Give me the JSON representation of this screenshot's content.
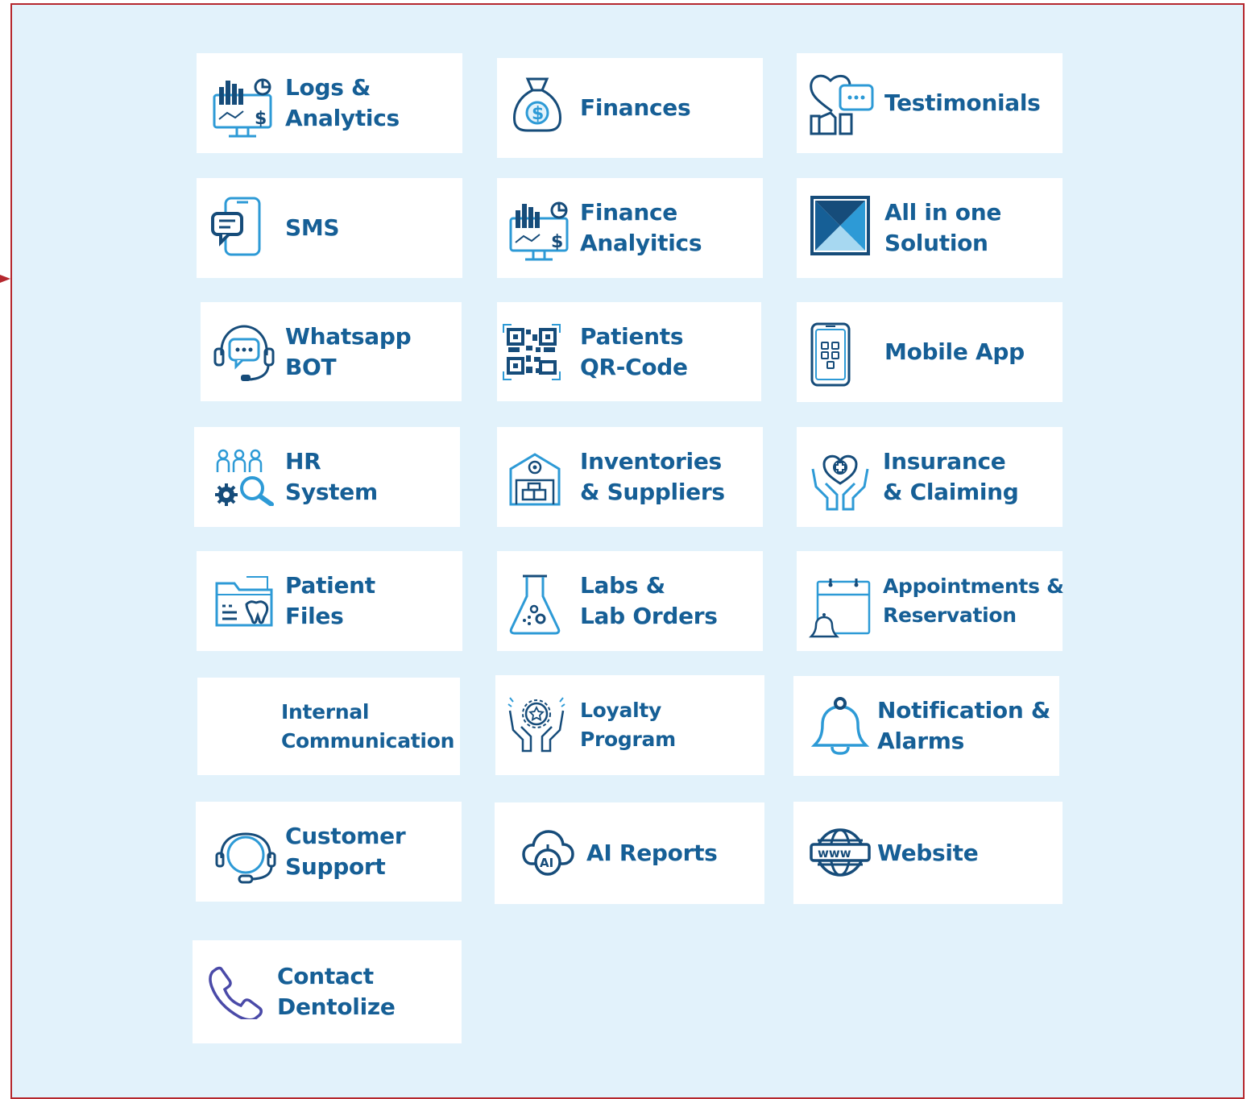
{
  "tiles": [
    {
      "id": "logs-analytics",
      "lines": [
        "Logs &",
        "Analytics"
      ],
      "icon": "analytics-monitor-icon"
    },
    {
      "id": "finances",
      "lines": [
        "Finances"
      ],
      "icon": "money-bag-icon"
    },
    {
      "id": "testimonials",
      "lines": [
        "Testimonials"
      ],
      "icon": "testimonial-heart-chat-icon"
    },
    {
      "id": "sms",
      "lines": [
        "SMS"
      ],
      "icon": "phone-message-icon"
    },
    {
      "id": "finance-analytics",
      "lines": [
        "Finance",
        "Analyitics"
      ],
      "icon": "analytics-monitor-icon"
    },
    {
      "id": "all-in-one",
      "lines": [
        "All in one",
        "Solution"
      ],
      "icon": "solution-logo-icon"
    },
    {
      "id": "whatsapp-bot",
      "lines": [
        "Whatsapp",
        "BOT"
      ],
      "icon": "headset-chat-icon"
    },
    {
      "id": "patients-qr",
      "lines": [
        "Patients",
        "QR-Code"
      ],
      "icon": "qr-code-icon"
    },
    {
      "id": "mobile-app",
      "lines": [
        "Mobile App"
      ],
      "icon": "smartphone-apps-icon"
    },
    {
      "id": "hr-system",
      "lines": [
        "HR",
        "System"
      ],
      "icon": "people-search-icon"
    },
    {
      "id": "inventories",
      "lines": [
        "Inventories",
        "& Suppliers"
      ],
      "icon": "warehouse-icon"
    },
    {
      "id": "insurance",
      "lines": [
        "Insurance",
        "& Claiming"
      ],
      "icon": "hands-heart-icon"
    },
    {
      "id": "patient-files",
      "lines": [
        "Patient",
        "Files"
      ],
      "icon": "dental-folder-icon"
    },
    {
      "id": "labs",
      "lines": [
        "Labs &",
        "Lab Orders"
      ],
      "icon": "lab-flask-icon"
    },
    {
      "id": "appointments",
      "lines": [
        "Appointments &",
        "Reservation"
      ],
      "icon": "calendar-bell-icon"
    },
    {
      "id": "internal-communication",
      "lines": [
        "Internal",
        "Communication"
      ],
      "icon": ""
    },
    {
      "id": "loyalty",
      "lines": [
        "Loyalty",
        "Program"
      ],
      "icon": "award-hands-icon"
    },
    {
      "id": "notifications",
      "lines": [
        "Notification &",
        "Alarms"
      ],
      "icon": "bell-icon"
    },
    {
      "id": "customer-support",
      "lines": [
        "Customer",
        "Support"
      ],
      "icon": "headset-icon"
    },
    {
      "id": "ai-reports",
      "lines": [
        "AI Reports"
      ],
      "icon": "ai-cloud-icon"
    },
    {
      "id": "website",
      "lines": [
        "Website"
      ],
      "icon": "www-globe-icon"
    },
    {
      "id": "contact",
      "lines": [
        "Contact",
        "Dentolize"
      ],
      "icon": "phone-handset-icon"
    }
  ],
  "colors": {
    "text": "#165f96",
    "accent": "#2d9ad6",
    "dark": "#164c7a",
    "background": "#e2f2fb",
    "border": "#b5282e"
  }
}
